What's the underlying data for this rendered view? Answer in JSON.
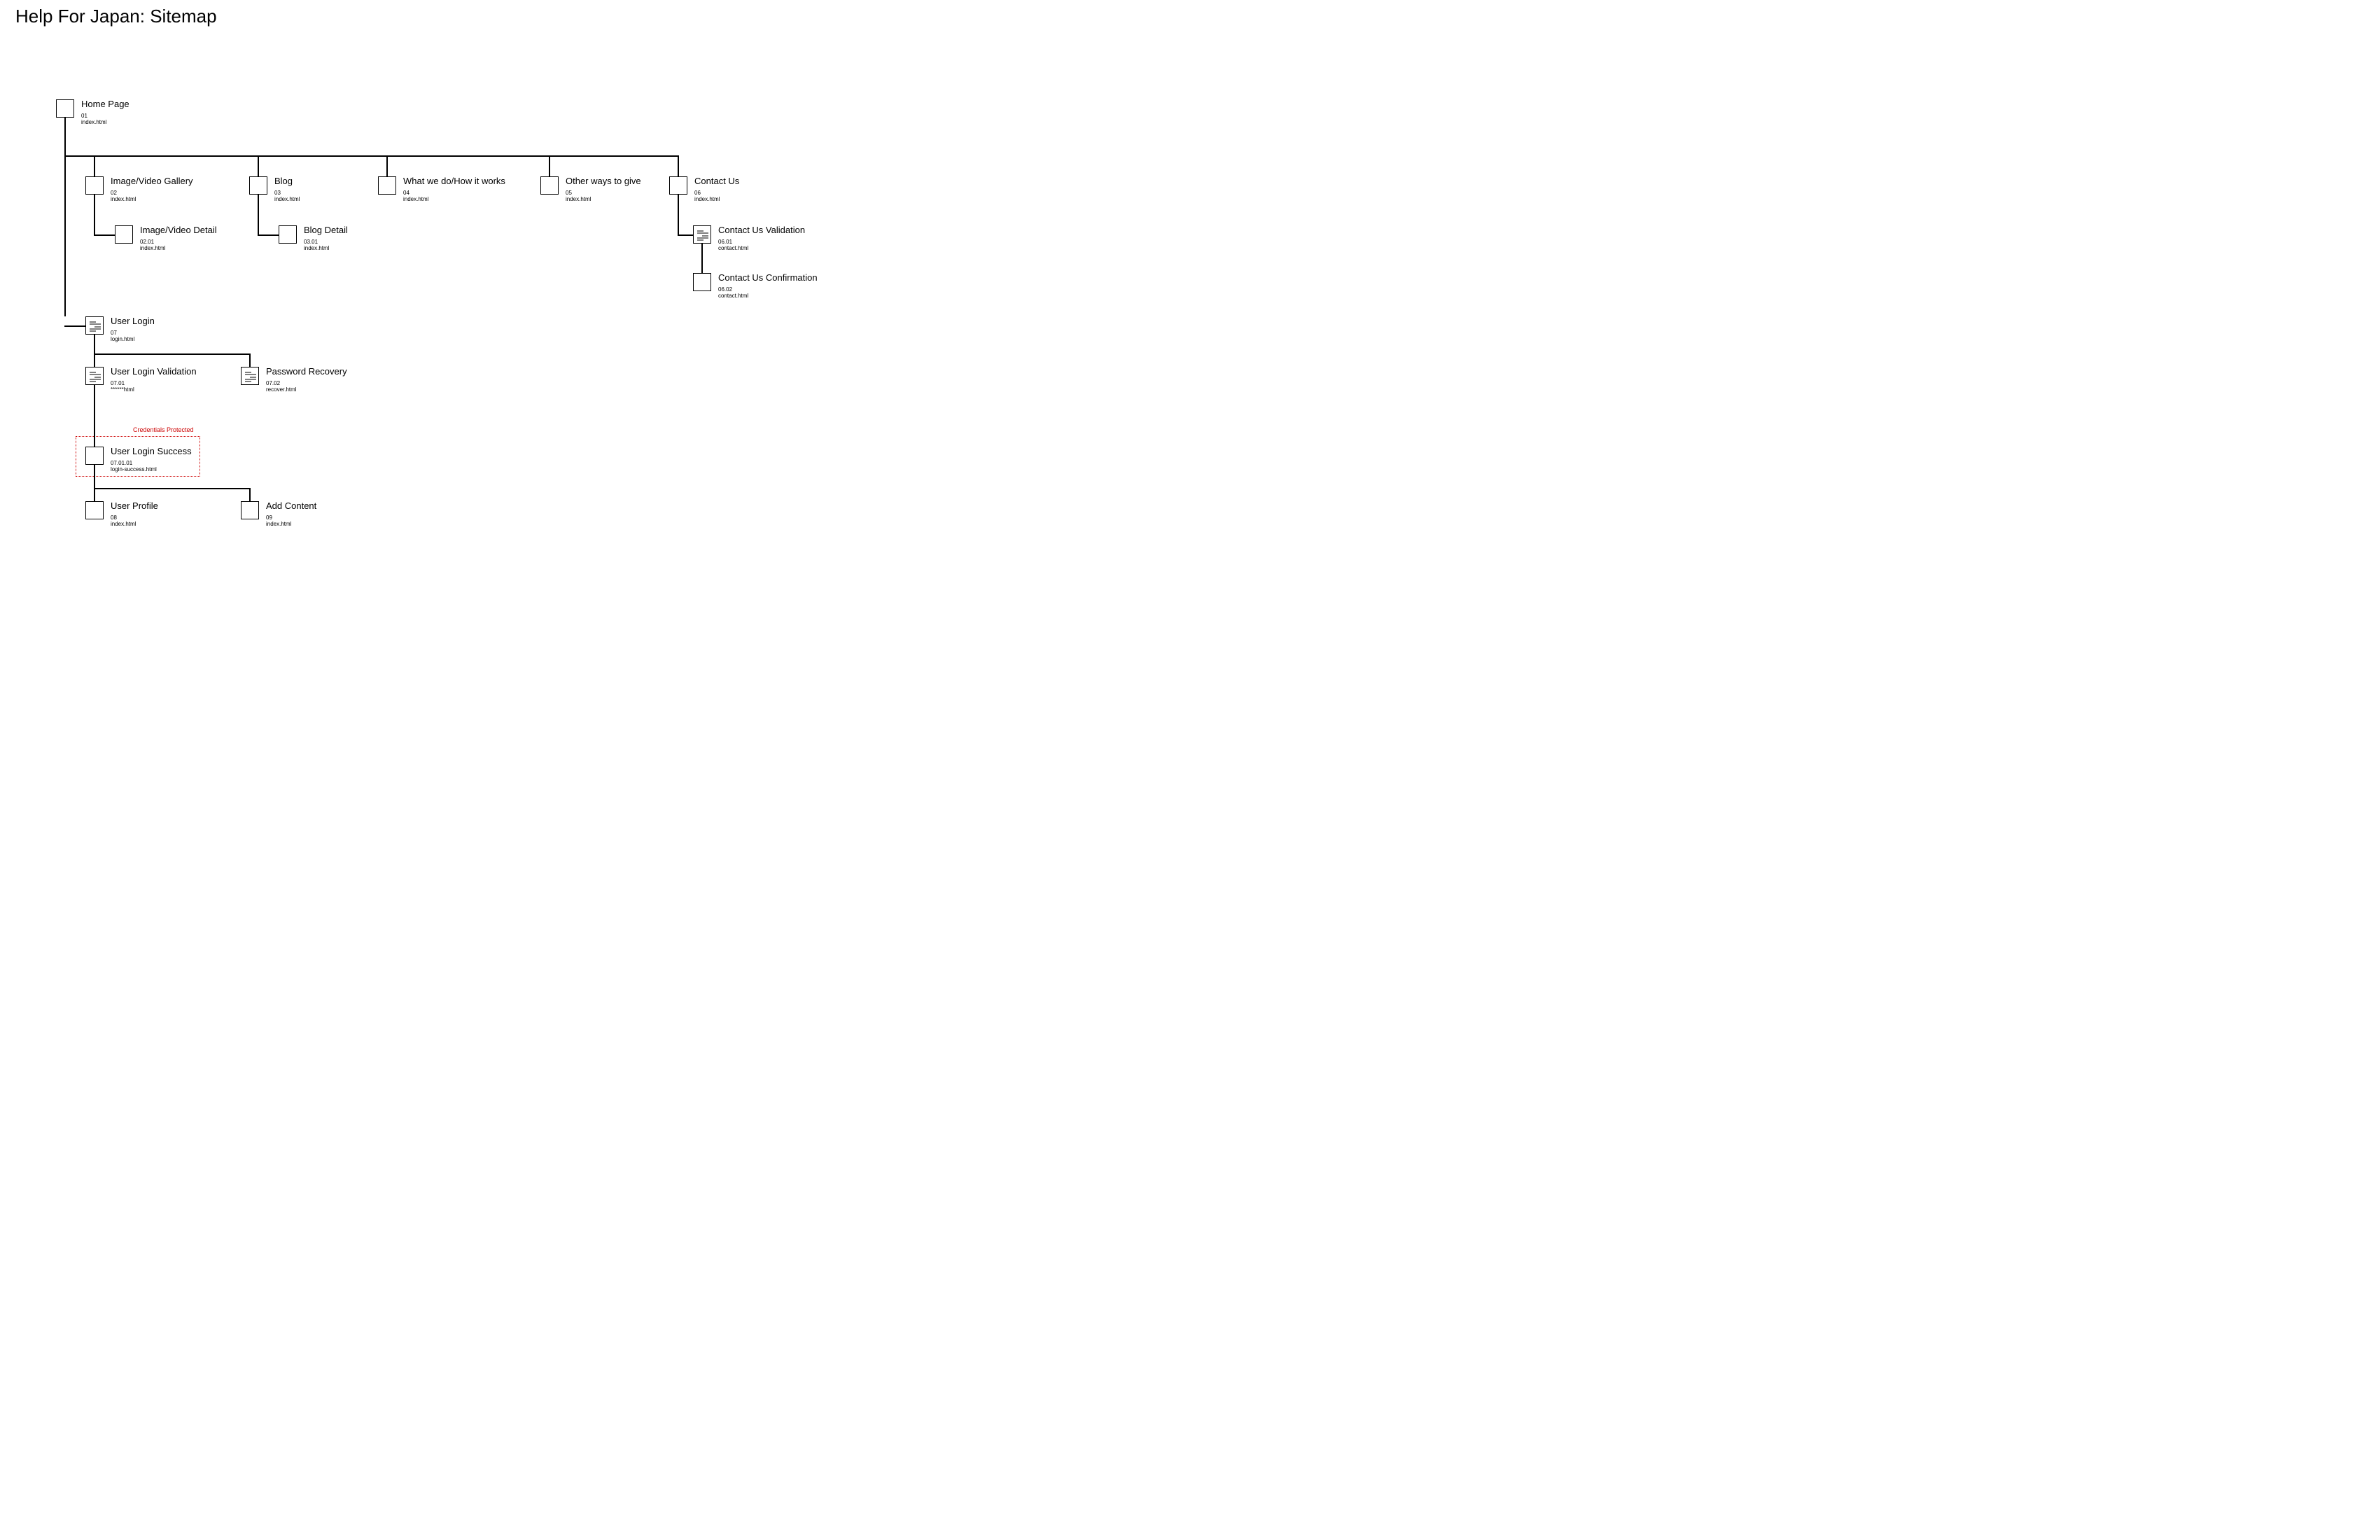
{
  "page_title": "Help For Japan: Sitemap",
  "protected_label": "Credentials Protected",
  "nodes": {
    "home": {
      "label": "Home Page",
      "num": "01",
      "file": "index.html"
    },
    "gallery": {
      "label": "Image/Video Gallery",
      "num": "02",
      "file": "index.html"
    },
    "gallery_d": {
      "label": "Image/Video Detail",
      "num": "02.01",
      "file": "index.html"
    },
    "blog": {
      "label": "Blog",
      "num": "03",
      "file": "index.html"
    },
    "blog_d": {
      "label": "Blog Detail",
      "num": "03.01",
      "file": "index.html"
    },
    "what": {
      "label": "What we do/How it works",
      "num": "04",
      "file": "index.html"
    },
    "other": {
      "label": "Other ways to give",
      "num": "05",
      "file": "index.html"
    },
    "contact": {
      "label": "Contact Us",
      "num": "06",
      "file": "index.html"
    },
    "contact_v": {
      "label": "Contact Us Validation",
      "num": "06.01",
      "file": "contact.html"
    },
    "contact_c": {
      "label": "Contact Us Confirmation",
      "num": "06.02",
      "file": "contact.html"
    },
    "login": {
      "label": "User Login",
      "num": "07",
      "file": "login.html"
    },
    "login_v": {
      "label": "User Login Validation",
      "num": "07.01",
      "file": "******html"
    },
    "recover": {
      "label": "Password Recovery",
      "num": "07.02",
      "file": "recover.html"
    },
    "login_s": {
      "label": "User Login Success",
      "num": "07.01.01",
      "file": "login-success.html"
    },
    "profile": {
      "label": "User Profile",
      "num": "08",
      "file": "index.html"
    },
    "addcontent": {
      "label": "Add Content",
      "num": "09",
      "file": "index.html"
    }
  }
}
